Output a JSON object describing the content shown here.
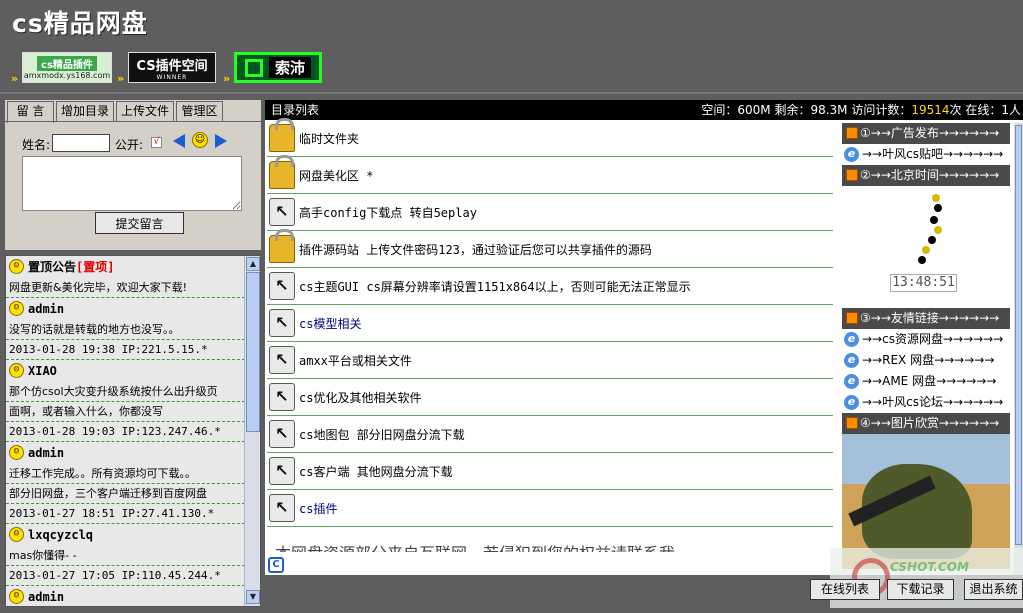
{
  "site_title": "cs精品网盘",
  "banners": [
    {
      "top": "cs精品插件",
      "bottom": "amxmodx.ys168.com"
    },
    {
      "top": "CS插件空间",
      "bottom": "WINNER"
    },
    {
      "top": "索沛",
      "bottom": ""
    }
  ],
  "arrows": "»",
  "left_tabs": [
    "留 言",
    "增加目录",
    "上传文件",
    "管理区"
  ],
  "form": {
    "name_label": "姓名:",
    "name_value": "",
    "public_label": "公开:",
    "public_checked": "√",
    "smile_icon": "☺",
    "submit_label": "提交留言"
  },
  "messages": [
    {
      "author": "置顶公告",
      "tag": "[置项]",
      "lines": [
        "网盘更新&美化完毕，欢迎大家下载!"
      ],
      "meta": ""
    },
    {
      "author": "admin",
      "tag": "",
      "lines": [
        "没写的话就是转载的地方也没写。。"
      ],
      "meta": "2013-01-28 19:38 IP:221.5.15.*"
    },
    {
      "author": "XIAO",
      "tag": "",
      "lines": [
        "那个仿csol大灾变升级系统按什么出升级页",
        "面啊，或者输入什么，你都没写"
      ],
      "meta": "2013-01-28 19:03 IP:123.247.46.*"
    },
    {
      "author": "admin",
      "tag": "",
      "lines": [
        "迁移工作完成。。所有资源均可下载。。",
        "部分旧网盘，三个客户端迁移到百度网盘"
      ],
      "meta": "2013-01-27 18:51 IP:27.41.130.*"
    },
    {
      "author": "lxqcyzclq",
      "tag": "",
      "lines": [
        "mas你懂得- -"
      ],
      "meta": "2013-01-27 17:05 IP:110.45.244.*"
    },
    {
      "author": "admin",
      "tag": "",
      "lines": [],
      "meta": ""
    }
  ],
  "main_bar": {
    "title": "目录列表",
    "stats_prefix": "空间：600M 剩余：98.3M 访问计数：",
    "visit_count": "19514",
    "stats_suffix": "次 在线：1人"
  },
  "directories": [
    {
      "icon": "lock",
      "name": "临时文件夹",
      "link": false
    },
    {
      "icon": "lock",
      "name": "网盘美化区 *",
      "link": false
    },
    {
      "icon": "cs",
      "name": "高手config下载点 转自5eplay",
      "link": false
    },
    {
      "icon": "lock",
      "name": "插件源码站 上传文件密码123，通过验证后您可以共享插件的源码",
      "link": false
    },
    {
      "icon": "cs",
      "name": "cs主题GUI cs屏幕分辨率请设置1151x864以上，否则可能无法正常显示",
      "link": false
    },
    {
      "icon": "cs",
      "name": "cs模型相关",
      "link": true
    },
    {
      "icon": "cs",
      "name": "amxx平台或相关文件",
      "link": false
    },
    {
      "icon": "cs",
      "name": "cs优化及其他相关软件",
      "link": false
    },
    {
      "icon": "cs",
      "name": "cs地图包 部分旧网盘分流下载",
      "link": false
    },
    {
      "icon": "cs",
      "name": "cs客户端 其他网盘分流下载",
      "link": false
    },
    {
      "icon": "cs",
      "name": "cs插件",
      "link": true
    }
  ],
  "notice": "本网盘资源部分来自互联网，若侵犯到您的权益请联系我",
  "side": {
    "ad_head": "①→→广告发布→→→→→→",
    "ad_link": "→→叶风cs贴吧→→→→→→",
    "time_head": "②→→北京时间→→→→→→",
    "clock": "13:48:51",
    "friends_head": "③→→友情链接→→→→→→",
    "friend_links": [
      "→→cs资源网盘→→→→→→",
      "→→REX 网盘→→→→→→",
      "→→AME 网盘→→→→→→",
      "→→叶风cs论坛→→→→→→"
    ],
    "pics_head": "④→→图片欣赏→→→→→→"
  },
  "bottom_buttons": [
    "在线列表",
    "下载记录",
    "退出系统"
  ],
  "watermark": "CSHOT.COM"
}
